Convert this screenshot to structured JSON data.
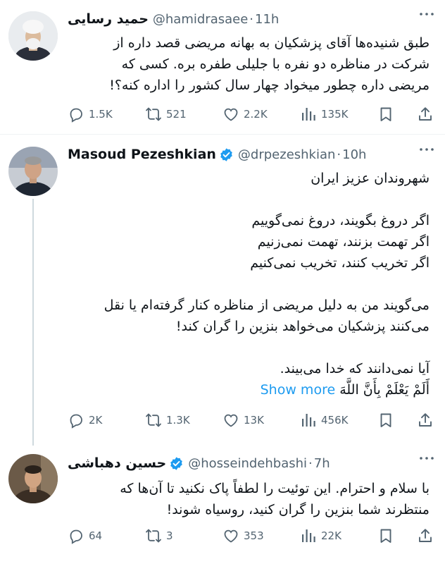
{
  "colors": {
    "accent": "#1d9bf0",
    "muted": "#536471",
    "text": "#0f1419"
  },
  "tweets": [
    {
      "name": "حمید رسایی",
      "handle": "@hamidrasaee",
      "time": "11h",
      "verified": false,
      "body": "طبق شنیده‌ها آقای پزشکیان به بهانه مریضی قصد داره از\nشرکت در مناظره دو نفره با جلیلی طفره بره. کسی که\nمریضی داره چطور میخواد چهار سال کشور را اداره کنه؟!",
      "show_more": "",
      "stats": {
        "replies": "1.5K",
        "retweets": "521",
        "likes": "2.2K",
        "views": "135K"
      }
    },
    {
      "name": "Masoud Pezeshkian",
      "handle": "@drpezeshkian",
      "time": "10h",
      "verified": true,
      "body": "شهروندان عزیز ایران\n\nاگر دروغ بگویند، دروغ نمی‌گوییم\nاگر تهمت بزنند، تهمت نمی‌زنیم\nاگر تخریب کنند، تخریب نمی‌کنیم\n\nمی‌گویند من به دلیل مریضی از مناظره کنار گرفته‌ام یا نقل\nمی‌کنند پزشکیان می‌خواهد بنزین را گران کند!\n\nآیا نمی‌دانند که خدا می‌بیند.\nأَلَمْ یَعْلَمْ بِأَنَّ اللَّهَ ",
      "show_more": "Show more",
      "stats": {
        "replies": "2K",
        "retweets": "1.3K",
        "likes": "13K",
        "views": "456K"
      }
    },
    {
      "name": "حسین دهباشی",
      "handle": "@hosseindehbashi",
      "time": "7h",
      "verified": true,
      "body": "با سلام و احترام. این توئیت را لطفاً پاک نکنید تا آن‌ها که\nمنتظرند شما بنزین را گران کنید، روسیاه شوند!",
      "show_more": "",
      "stats": {
        "replies": "64",
        "retweets": "3",
        "likes": "353",
        "views": "22K"
      }
    }
  ]
}
